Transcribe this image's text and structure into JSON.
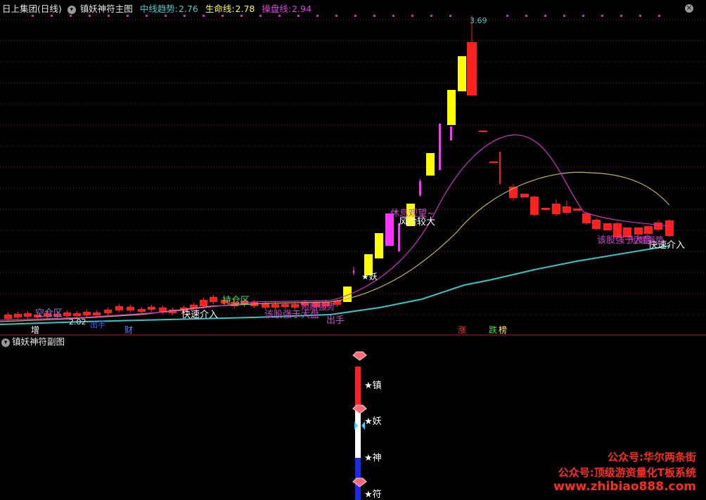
{
  "header": {
    "stock_name": "日上集团(日线)",
    "indicator_name": "镇妖神符主图",
    "indicators": [
      {
        "label": "中线趋势:",
        "value": "2.76",
        "color": "#3fd0d0"
      },
      {
        "label": "生命线:",
        "value": "2.78",
        "color": "#ffff33"
      },
      {
        "label": "操盘线:",
        "value": "2.94",
        "color": "#e040e0"
      }
    ],
    "dropdown_icon": "chevron-down-icon",
    "close_icon": "close-icon"
  },
  "sub_header": {
    "indicator_name": "镇妖神符副图"
  },
  "colors": {
    "up": "#ff2020",
    "yellow_candle": "#ffff00",
    "magenta_candle": "#ff33ff",
    "cyan_line": "#30c8c8",
    "yellow_line": "#c8b060",
    "magenta_line": "#d030d0",
    "grid": "#8a1a1a"
  },
  "annotations": {
    "peak_price": "3.69",
    "low_price": "2.02",
    "zones": [
      "空仓区",
      "持仓区"
    ],
    "white_labels": [
      "快速介入",
      "风险较大",
      "★妖",
      "快速介入"
    ],
    "magenta_labels": [
      "该股强于大盘",
      "休息观望~",
      "该股强于大盘",
      "出手",
      "出手",
      "短期强势",
      "短期强势"
    ],
    "bottom_marks": [
      "增",
      "财",
      "涨",
      "跌",
      "榜"
    ]
  },
  "sub_chart": {
    "labels": [
      "★镇",
      "★妖",
      "★神",
      "★符"
    ]
  },
  "watermark": {
    "line1": "公众号:华尔两条街",
    "line2": "公众号:顶级游资量化T板系统",
    "line3": "www.zhibiao888.com"
  }
}
